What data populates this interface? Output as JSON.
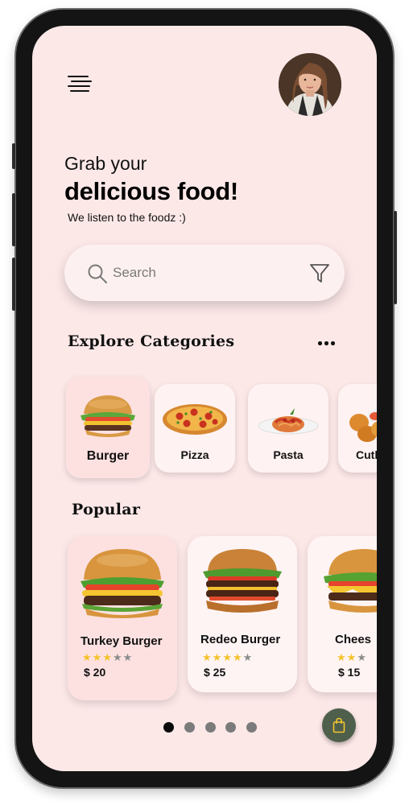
{
  "header": {
    "menu_icon": "hamburger-menu-icon",
    "avatar": "user-avatar"
  },
  "greeting": {
    "line1": "Grab your",
    "line2": "delicious food!",
    "tagline": "We listen to the foodz :)"
  },
  "search": {
    "placeholder": "Search",
    "value": "",
    "search_icon": "search-icon",
    "filter_icon": "filter-icon"
  },
  "categories": {
    "title": "Explore Categories",
    "more_icon": "more-dots-icon",
    "items": [
      {
        "label": "Burger",
        "selected": true
      },
      {
        "label": "Pizza",
        "selected": false
      },
      {
        "label": "Pasta",
        "selected": false
      },
      {
        "label": "Cutl",
        "selected": false
      }
    ]
  },
  "popular": {
    "title": "Popular",
    "items": [
      {
        "name": "Turkey Burger",
        "rating": 3,
        "max_rating": 5,
        "price": "$ 20"
      },
      {
        "name": "Redeo Burger",
        "rating": 4,
        "max_rating": 5,
        "price": "$ 25"
      },
      {
        "name": "Chees",
        "rating": 2,
        "max_rating": 3,
        "price": "$ 15"
      }
    ]
  },
  "pagination": {
    "count": 5,
    "active": 0
  },
  "bag": {
    "icon": "shopping-bag-icon"
  },
  "colors": {
    "background": "#fde8e8",
    "card": "#fff4f4",
    "card_active": "#fde1e1",
    "star": "#f4c22b",
    "bag_button": "#4e5f4c"
  }
}
